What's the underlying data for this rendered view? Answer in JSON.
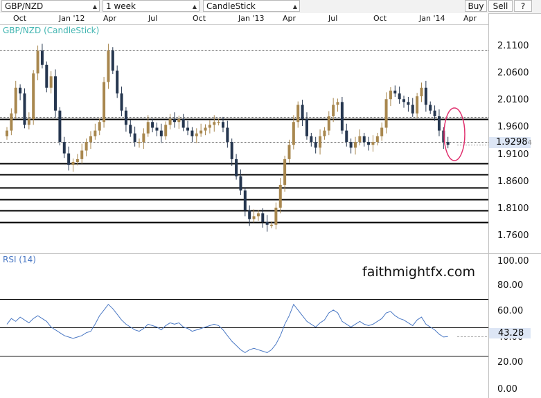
{
  "toolbar": {
    "symbol": "GBP/NZD",
    "interval": "1 week",
    "chart_type": "CandleStick",
    "buy_label": "Buy",
    "sell_label": "Sell",
    "help_label": "?"
  },
  "timeline": [
    "Oct",
    "Jan '12",
    "Apr",
    "Jul",
    "Oct",
    "Jan '13",
    "Apr",
    "Jul",
    "Oct",
    "Jan '14",
    "Apr"
  ],
  "price_panel": {
    "title": "GBP/NZD (CandleStick)",
    "y_ticks": [
      "2.1100",
      "2.0600",
      "2.0100",
      "1.9600",
      "1.9100",
      "1.8600",
      "1.8100",
      "1.7600"
    ],
    "current_price": "1.9298",
    "current_price_suffix": "4"
  },
  "rsi_panel": {
    "title": "RSI (14)",
    "y_ticks": [
      "100.00",
      "80.00",
      "60.00",
      "40.00",
      "20.00",
      "0.00"
    ],
    "current_value": "43.28"
  },
  "watermark": "faithmightfx.com",
  "colors": {
    "bull": "#a8874e",
    "bear": "#25364f",
    "rsi_line": "#4a78c4",
    "title": "#3fb4b0",
    "ellipse": "#e0306e",
    "current_box": "#dde6f5"
  },
  "chart_data": [
    {
      "type": "candlestick",
      "title": "GBP/NZD (CandleStick)",
      "x_labels": [
        "Oct",
        "Jan '12",
        "Apr",
        "Jul",
        "Oct",
        "Jan '13",
        "Apr",
        "Jul",
        "Oct",
        "Jan '14",
        "Apr"
      ],
      "ylim": [
        1.74,
        2.14
      ],
      "closes": [
        1.955,
        1.985,
        2.03,
        2.02,
        1.965,
        1.975,
        2.055,
        2.095,
        2.07,
        2.03,
        2.05,
        1.99,
        1.935,
        1.915,
        1.895,
        1.9,
        1.905,
        1.92,
        1.935,
        1.945,
        1.955,
        1.97,
        2.04,
        2.095,
        2.06,
        2.02,
        1.99,
        1.965,
        1.95,
        1.935,
        1.935,
        1.95,
        1.97,
        1.96,
        1.955,
        1.945,
        1.965,
        1.975,
        1.97,
        1.975,
        1.96,
        1.955,
        1.945,
        1.95,
        1.955,
        1.96,
        1.965,
        1.97,
        1.97,
        1.96,
        1.935,
        1.905,
        1.875,
        1.85,
        1.815,
        1.8,
        1.805,
        1.81,
        1.795,
        1.79,
        1.79,
        1.82,
        1.86,
        1.905,
        1.93,
        1.97,
        2.0,
        1.975,
        1.945,
        1.935,
        1.925,
        1.945,
        1.955,
        1.98,
        2.0,
        2.005,
        1.955,
        1.935,
        1.925,
        1.935,
        1.945,
        1.935,
        1.93,
        1.935,
        1.945,
        1.96,
        2.01,
        2.025,
        2.02,
        2.01,
        2.005,
        2.0,
        1.985,
        2.015,
        2.03,
        2.0,
        1.99,
        1.98,
        1.955,
        1.935,
        1.93
      ],
      "horizontal_levels": [
        1.979,
        1.975,
        1.935,
        1.898,
        1.878,
        1.855,
        1.835,
        1.815,
        1.795
      ],
      "current_price": 1.9298
    },
    {
      "type": "line",
      "title": "RSI (14)",
      "ylim": [
        0,
        100
      ],
      "reference_levels": [
        70,
        50,
        30
      ],
      "values": [
        52,
        56,
        54,
        57,
        55,
        53,
        56,
        58,
        56,
        54,
        50,
        48,
        46,
        44,
        43,
        42,
        43,
        44,
        46,
        47,
        52,
        58,
        62,
        66,
        63,
        59,
        55,
        52,
        50,
        48,
        47,
        49,
        52,
        51,
        50,
        48,
        51,
        53,
        52,
        53,
        50,
        49,
        47,
        48,
        49,
        50,
        51,
        52,
        51,
        48,
        44,
        40,
        37,
        34,
        32,
        34,
        35,
        34,
        33,
        32,
        34,
        38,
        44,
        52,
        58,
        66,
        62,
        58,
        54,
        52,
        50,
        53,
        55,
        60,
        62,
        60,
        54,
        52,
        50,
        52,
        54,
        52,
        51,
        52,
        54,
        56,
        60,
        61,
        58,
        56,
        55,
        53,
        51,
        55,
        57,
        52,
        50,
        48,
        45,
        43,
        43.28
      ],
      "current_value": 43.28
    }
  ]
}
